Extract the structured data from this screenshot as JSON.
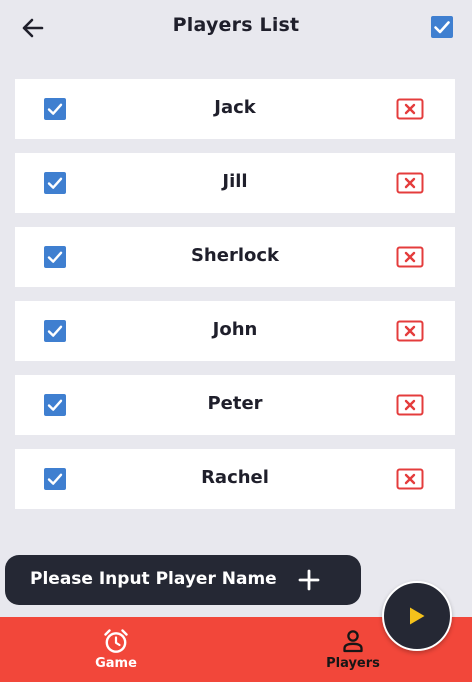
{
  "header": {
    "title": "Players List",
    "back_icon": "arrow-left-icon",
    "select_all_icon": "checkbox-checked-icon",
    "select_all_checked": true
  },
  "players": [
    {
      "name": "Jack",
      "checked": true
    },
    {
      "name": "Jill",
      "checked": true
    },
    {
      "name": "Sherlock",
      "checked": true
    },
    {
      "name": "John",
      "checked": true
    },
    {
      "name": "Peter",
      "checked": true
    },
    {
      "name": "Rachel",
      "checked": true
    }
  ],
  "input": {
    "placeholder": "Please Input Player Name",
    "value": "",
    "add_icon": "plus-icon"
  },
  "fab": {
    "icon": "play-icon"
  },
  "bottom_nav": {
    "items": [
      {
        "label": "Game",
        "icon": "alarm-clock-icon",
        "active": true
      },
      {
        "label": "Players",
        "icon": "person-icon",
        "active": false
      }
    ]
  },
  "colors": {
    "background": "#e8e8ee",
    "card": "#ffffff",
    "checkbox": "#3f7fd0",
    "delete": "#e43c3c",
    "dark": "#252834",
    "nav": "#f2473a"
  }
}
